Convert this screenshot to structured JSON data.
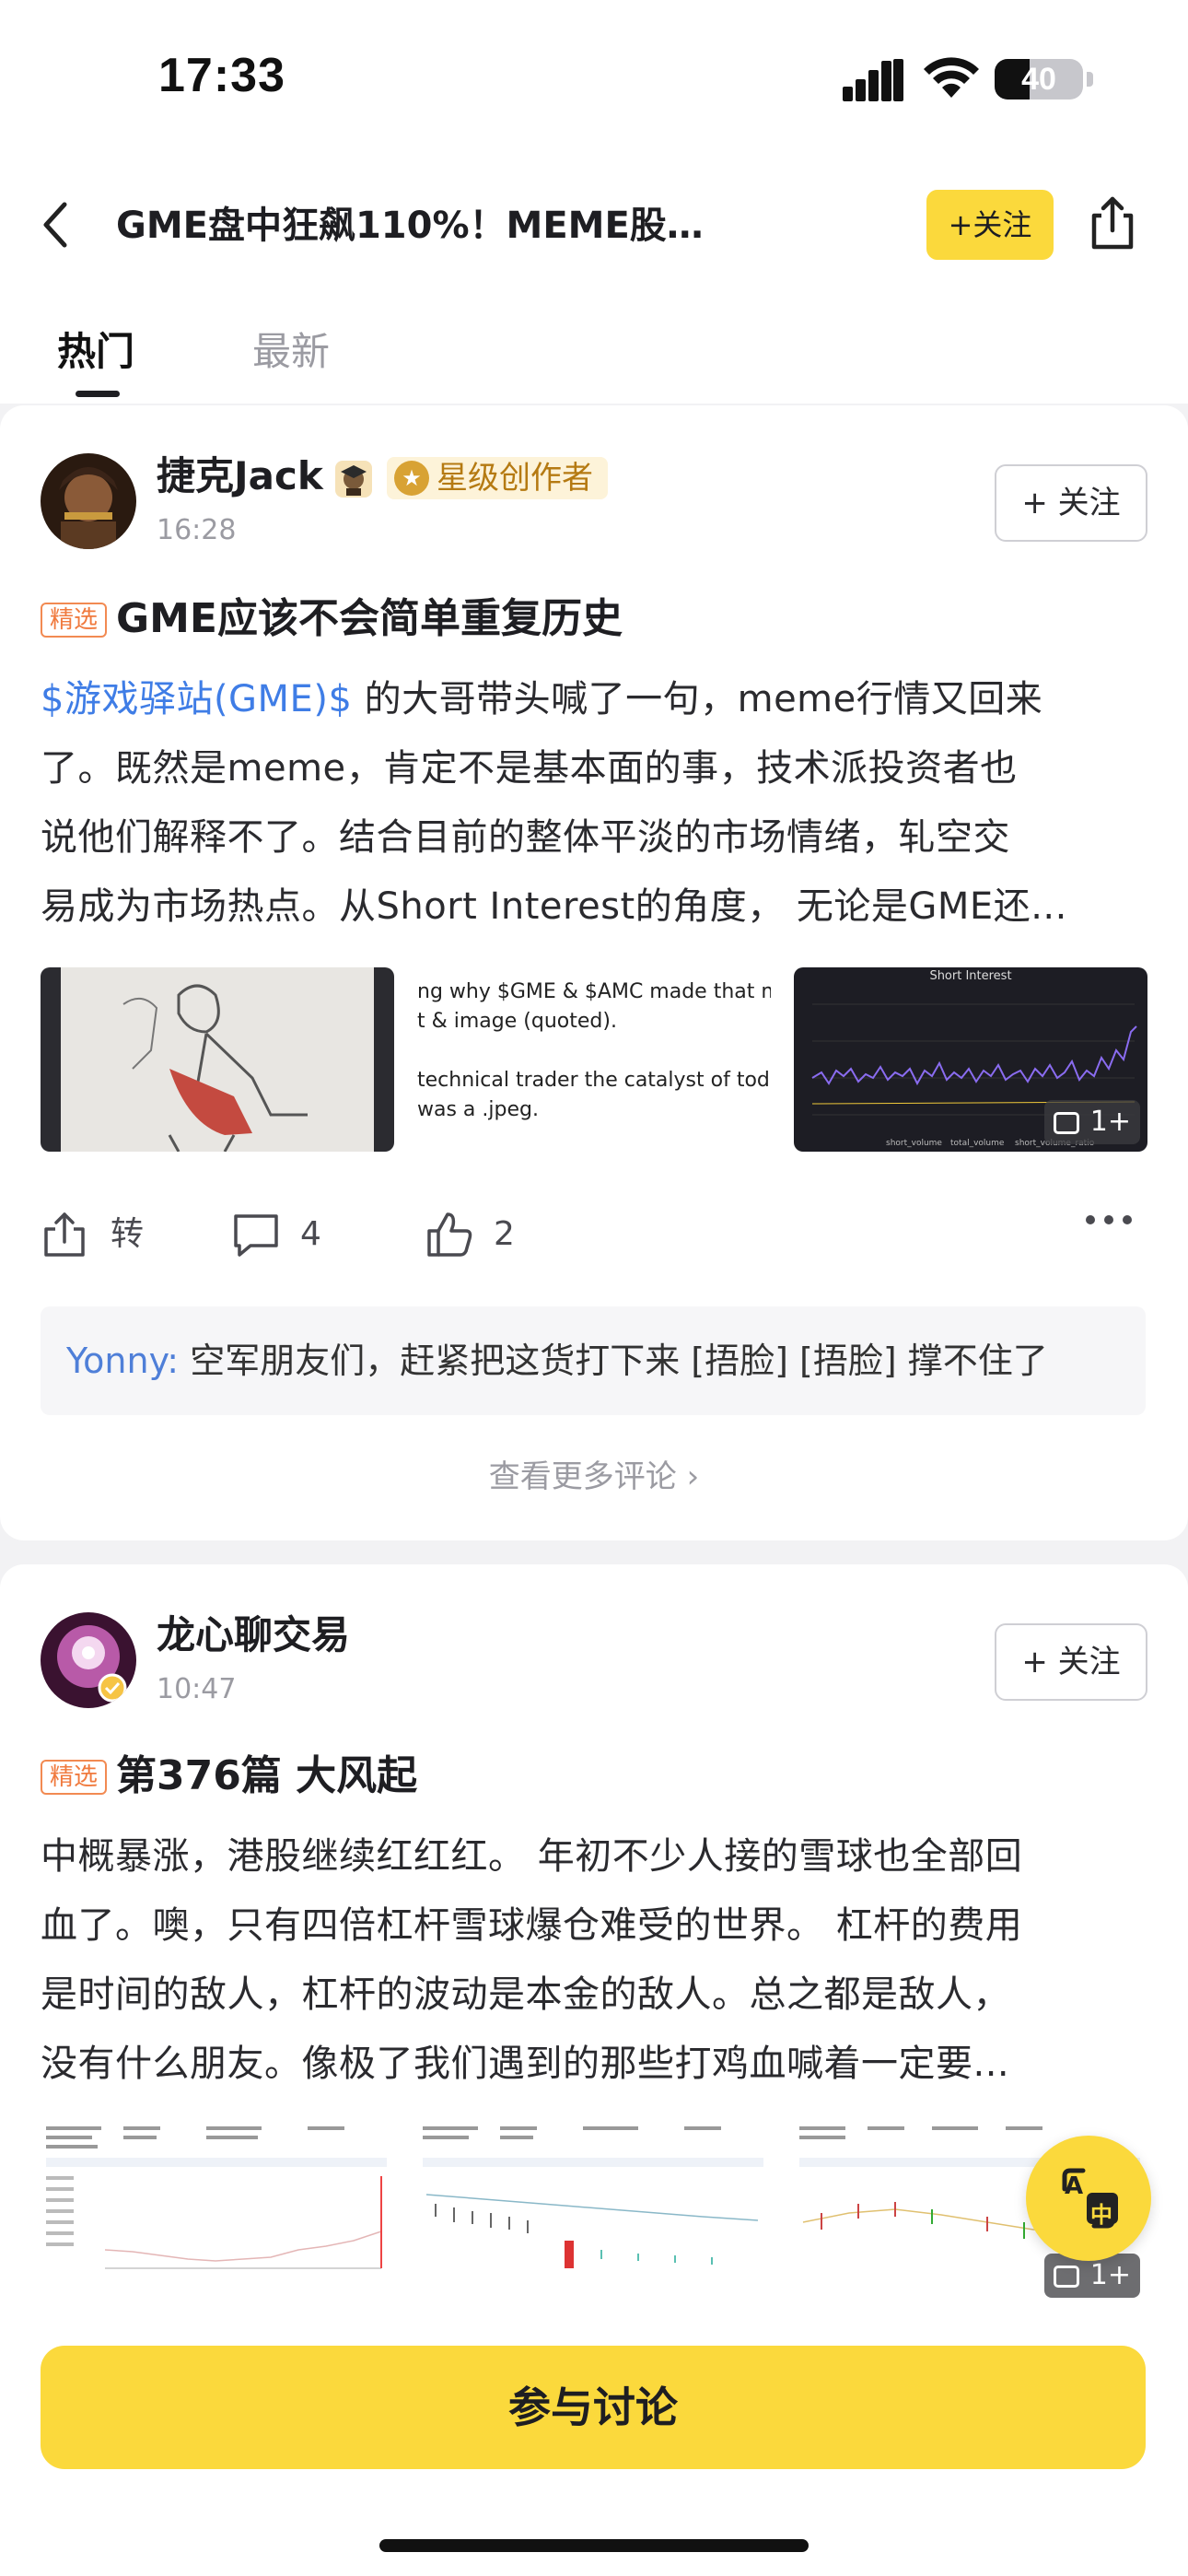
{
  "status_bar": {
    "time": "17:33",
    "battery": "40",
    "battery_level": 0.4
  },
  "nav": {
    "title": "GME盘中狂飙110%！MEME股...",
    "follow_label": "+关注"
  },
  "tabs": [
    {
      "label": "热门",
      "active": true
    },
    {
      "label": "最新",
      "active": false
    }
  ],
  "posts": [
    {
      "author": "捷克Jack",
      "badge": "星级创作者",
      "time": "16:28",
      "follow_label": "+ 关注",
      "tag": "精选",
      "title": "GME应该不会简单重复历史",
      "body_link": "$游戏驿站(GME)$",
      "body_lines": [
        " 的大哥带头喊了一句，meme行情又回来",
        "了。既然是meme，肯定不是基本面的事，技术派投资者也",
        "说他们解释不了。结合目前的整体平淡的市场情绪，轧空交",
        "易成为市场热点。从Short Interest的角度， 无论是GME还..."
      ],
      "image2_lines": [
        "ng why $GME & $AMC made that mov",
        "t & image (quoted).",
        "technical trader the catalyst of today",
        "was a .jpeg."
      ],
      "image3_title": "Short Interest",
      "image3_legend": [
        "short_volume",
        "total_volume",
        "short_volume_ratio"
      ],
      "more_images": "1+",
      "actions": {
        "repost": "转",
        "comments": "4",
        "likes": "2"
      },
      "comment": {
        "user": "Yonny:",
        "text": " 空军朋友们，赶紧把这货打下来 [捂脸] [捂脸] 撑不住了"
      },
      "more_comments": "查看更多评论"
    },
    {
      "author": "龙心聊交易",
      "time": "10:47",
      "follow_label": "+ 关注",
      "tag": "精选",
      "title": "第376篇 大风起",
      "body_lines": [
        "中概暴涨，港股继续红红红。 年初不少人接的雪球也全部回",
        "血了。噢，只有四倍杠杆雪球爆仓难受的世界。 杠杆的费用",
        "是时间的敌人，杠杆的波动是本金的敌人。总之都是敌人，",
        "没有什么朋友。像极了我们遇到的那些打鸡血喊着一定要..."
      ],
      "more_images": "1+"
    }
  ],
  "ai_button": {
    "top": "A",
    "bottom": "中"
  },
  "join_button": "参与讨论",
  "colors": {
    "accent": "#fbd93c",
    "link": "#3f7de6",
    "tag": "#f07a3e"
  }
}
